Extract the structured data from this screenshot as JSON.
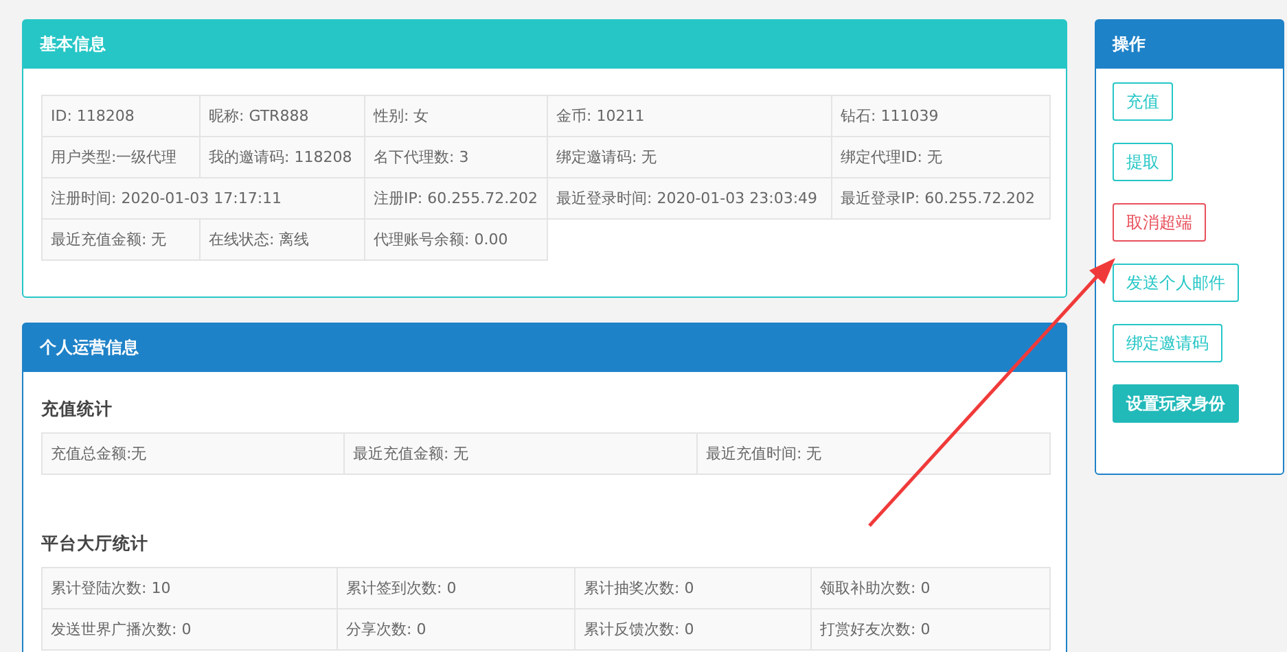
{
  "basic_info": {
    "title": "基本信息",
    "rows": [
      [
        {
          "text": "ID: 118208"
        },
        {
          "text": "昵称: GTR888"
        },
        {
          "text": "性别: 女"
        },
        {
          "text": "金币: 10211"
        },
        {
          "text": "钻石: 111039"
        }
      ],
      [
        {
          "text": "用户类型:一级代理"
        },
        {
          "text": "我的邀请码: 118208"
        },
        {
          "text": "名下代理数: 3"
        },
        {
          "text": "绑定邀请码: 无"
        },
        {
          "text": "绑定代理ID: 无"
        }
      ],
      [
        {
          "text": "注册时间: 2020-01-03 17:17:11",
          "colspan": 2
        },
        {
          "text": "注册IP: 60.255.72.202"
        },
        {
          "text": "最近登录时间: 2020-01-03 23:03:49"
        },
        {
          "text": "最近登录IP: 60.255.72.202"
        }
      ],
      [
        {
          "text": "最近充值金额: 无"
        },
        {
          "text": "在线状态: 离线"
        },
        {
          "text": "代理账号余额: 0.00"
        }
      ]
    ]
  },
  "operation_info": {
    "title": "个人运营信息",
    "sections": [
      {
        "heading": "充值统计",
        "rows": [
          [
            "充值总金额:无",
            "最近充值金额: 无",
            "最近充值时间: 无"
          ]
        ]
      },
      {
        "heading": "平台大厅统计",
        "rows": [
          [
            "累计登陆次数: 10",
            "累计签到次数: 0",
            "累计抽奖次数: 0",
            "领取补助次数: 0"
          ],
          [
            "发送世界广播次数: 0",
            "分享次数: 0",
            "累计反馈次数: 0",
            "打赏好友次数: 0"
          ]
        ]
      }
    ]
  },
  "actions": {
    "title": "操作",
    "buttons": [
      {
        "label": "充值",
        "kind": "outline"
      },
      {
        "label": "提取",
        "kind": "outline"
      },
      {
        "label": "取消超端",
        "kind": "danger"
      },
      {
        "label": "发送个人邮件",
        "kind": "outline"
      },
      {
        "label": "绑定邀请码",
        "kind": "outline"
      },
      {
        "label": "设置玩家身份",
        "kind": "primary"
      }
    ]
  },
  "annotation": {
    "kind": "arrow"
  }
}
